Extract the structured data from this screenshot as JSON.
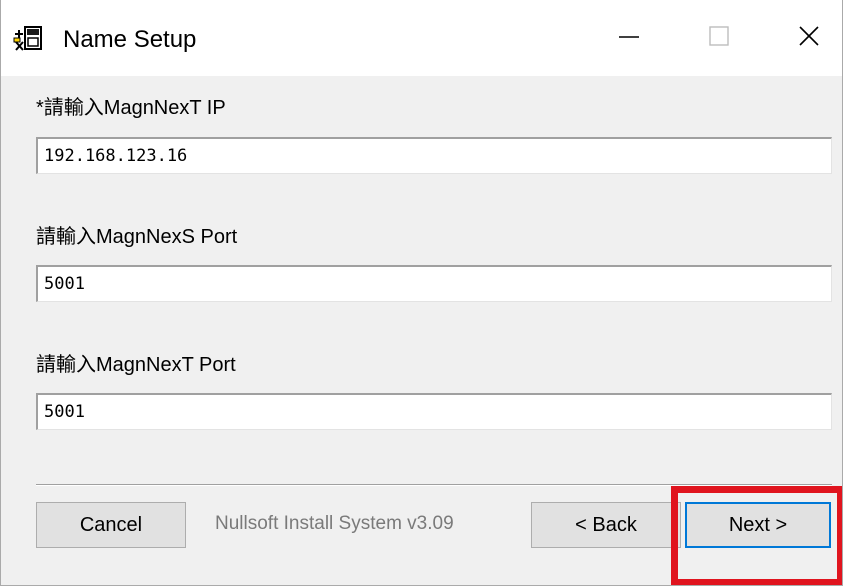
{
  "window": {
    "title": "Name Setup",
    "icons": {
      "app": "installer-icon",
      "minimize": "minimize-icon",
      "maximize": "maximize-icon",
      "close": "close-icon"
    }
  },
  "fields": [
    {
      "label": "*請輸入MagnNexT IP",
      "value": "192.168.123.16"
    },
    {
      "label": "請輸入MagnNexS Port",
      "value": "5001"
    },
    {
      "label": "請輸入MagnNexT Port",
      "value": "5001"
    }
  ],
  "footer": {
    "cancel_label": "Cancel",
    "branding": "Nullsoft Install System v3.09",
    "back_label": "< Back",
    "next_label": "Next >"
  },
  "colors": {
    "highlight": "#e0141e",
    "focus_border": "#0078d7"
  }
}
